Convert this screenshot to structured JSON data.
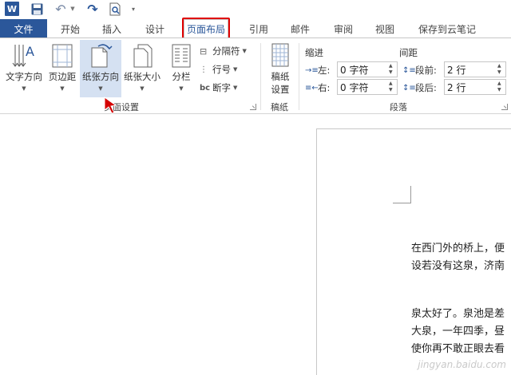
{
  "qat": {
    "word_label": "W",
    "icons": [
      "word-app-icon",
      "save-icon",
      "undo-icon",
      "redo-icon",
      "print-preview-icon",
      "customize-qat-icon"
    ]
  },
  "tabs": {
    "file": "文件",
    "items": [
      "开始",
      "插入",
      "设计",
      "页面布局",
      "引用",
      "邮件",
      "审阅",
      "视图",
      "保存到云笔记"
    ],
    "active": "页面布局"
  },
  "ribbon": {
    "page_setup": {
      "buttons": [
        {
          "label": "文字方向",
          "icon": "text-direction-icon"
        },
        {
          "label": "页边距",
          "icon": "margins-icon"
        },
        {
          "label": "纸张方向",
          "icon": "orientation-icon"
        },
        {
          "label": "纸张大小",
          "icon": "paper-size-icon"
        },
        {
          "label": "分栏",
          "icon": "columns-icon"
        }
      ],
      "small": [
        {
          "label": "分隔符",
          "icon": "breaks-icon"
        },
        {
          "label": "行号",
          "icon": "line-numbers-icon"
        },
        {
          "label": "断字",
          "icon": "hyphenation-icon"
        }
      ],
      "group_label": "页面设置"
    },
    "manuscript": {
      "button_line1": "稿纸",
      "button_line2": "设置",
      "group_label": "稿纸"
    },
    "paragraph": {
      "indent_title": "缩进",
      "spacing_title": "间距",
      "left_label": "左:",
      "left_value": "0 字符",
      "right_label": "右:",
      "right_value": "0 字符",
      "before_label": "段前:",
      "before_value": "2 行",
      "after_label": "段后:",
      "after_value": "2 行",
      "group_label": "段落"
    }
  },
  "document": {
    "lines": [
      "在西门外的桥上，便",
      "设若没有这泉，济南",
      "泉太好了。泉池是差",
      "大泉，一年四季，昼",
      "使你再不敢正眼去看"
    ]
  },
  "colors": {
    "accent": "#2b579a",
    "highlight_box": "#e00000",
    "pointer": "#d40000"
  },
  "watermark": "jingyan.baidu.com"
}
